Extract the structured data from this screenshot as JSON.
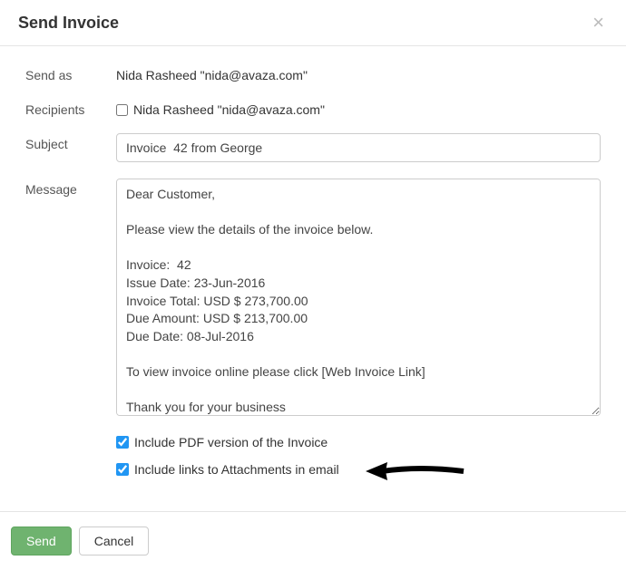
{
  "header": {
    "title": "Send Invoice",
    "close": "×"
  },
  "form": {
    "send_as_label": "Send as",
    "send_as_value": "Nida Rasheed \"nida@avaza.com\"",
    "recipients_label": "Recipients",
    "recipient_name": "Nida Rasheed \"nida@avaza.com\"",
    "subject_label": "Subject",
    "subject_value": "Invoice  42 from George",
    "message_label": "Message",
    "message_value": "Dear Customer,\n\nPlease view the details of the invoice below.\n\nInvoice:  42\nIssue Date: 23-Jun-2016\nInvoice Total: USD $ 273,700.00\nDue Amount: USD $ 213,700.00\nDue Date: 08-Jul-2016\n\nTo view invoice online please click [Web Invoice Link]\n\nThank you for your business\nGeorge",
    "include_pdf_label": "Include PDF version of the Invoice",
    "include_attachments_label": "Include links to Attachments in email"
  },
  "footer": {
    "send_label": "Send",
    "cancel_label": "Cancel"
  }
}
